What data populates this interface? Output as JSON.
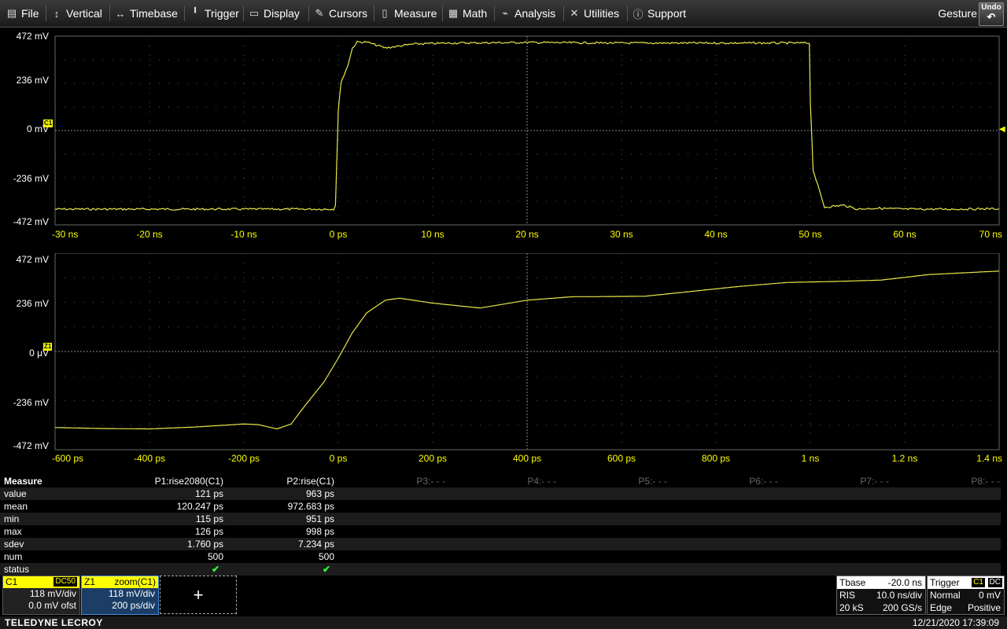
{
  "menu": {
    "items": [
      {
        "label": "File",
        "icon": "file-icon"
      },
      {
        "label": "Vertical",
        "icon": "vertical-arrows-icon"
      },
      {
        "label": "Timebase",
        "icon": "horizontal-arrows-icon"
      },
      {
        "label": "Trigger",
        "icon": "trigger-icon"
      },
      {
        "label": "Display",
        "icon": "display-icon"
      },
      {
        "label": "Cursors",
        "icon": "cursors-icon"
      },
      {
        "label": "Measure",
        "icon": "measure-icon"
      },
      {
        "label": "Math",
        "icon": "math-icon"
      },
      {
        "label": "Analysis",
        "icon": "analysis-icon"
      },
      {
        "label": "Utilities",
        "icon": "utilities-icon"
      },
      {
        "label": "Support",
        "icon": "support-icon"
      }
    ],
    "gesture_label": "Gesture",
    "undo_label": "Undo"
  },
  "chart_data": [
    {
      "type": "line",
      "title": "",
      "channel_tag": "C1",
      "y_tick_labels": [
        "472 mV",
        "236 mV",
        "0 mV",
        "-236 mV",
        "-472 mV"
      ],
      "x_tick_labels": [
        "-30 ns",
        "-20 ns",
        "-10 ns",
        "0 ps",
        "10 ns",
        "20 ns",
        "30 ns",
        "40 ns",
        "50 ns",
        "60 ns",
        "70 ns"
      ],
      "xlim_ns": [
        -30,
        70
      ],
      "ylim_mV": [
        -472,
        472
      ],
      "trace_color": "#e8e84a",
      "series": [
        {
          "x_ns": [
            -30,
            -0.5,
            -0.3,
            0,
            0.3,
            0.6,
            1.0,
            1.5,
            2.0,
            3.0,
            5.0,
            8.0,
            12.0,
            20.0,
            30.0,
            40.0,
            49.9,
            50.0,
            50.3,
            50.6,
            51.5,
            53.5,
            55.0,
            57.0,
            60.0,
            65.0,
            70.0
          ],
          "y_mV": [
            -400,
            -400,
            -380,
            100,
            250,
            280,
            330,
            420,
            450,
            450,
            420,
            440,
            445,
            448,
            445,
            445,
            445,
            150,
            -200,
            -250,
            -390,
            -380,
            -400,
            -395,
            -400,
            -400,
            -398
          ]
        }
      ]
    },
    {
      "type": "line",
      "title": "",
      "channel_tag": "Z1",
      "y_tick_labels": [
        "472 mV",
        "236 mV",
        "0 μV",
        "-236 mV",
        "-472 mV"
      ],
      "x_tick_labels": [
        "-600 ps",
        "-400 ps",
        "-200 ps",
        "0 ps",
        "200 ps",
        "400 ps",
        "600 ps",
        "800 ps",
        "1 ns",
        "1.2 ns",
        "1.4 ns"
      ],
      "xlim_ps": [
        -600,
        1400
      ],
      "ylim_mV": [
        -472,
        472
      ],
      "trace_color": "#e8e84a",
      "series": [
        {
          "x_ps": [
            -600,
            -500,
            -400,
            -300,
            -200,
            -170,
            -130,
            -100,
            -70,
            -30,
            0,
            30,
            60,
            100,
            130,
            200,
            300,
            400,
            500,
            550,
            650,
            750,
            850,
            950,
            1050,
            1150,
            1250,
            1400
          ],
          "y_mV": [
            -383,
            -388,
            -390,
            -380,
            -365,
            -368,
            -390,
            -365,
            -270,
            -150,
            -30,
            100,
            200,
            265,
            275,
            250,
            225,
            265,
            283,
            283,
            285,
            310,
            335,
            355,
            360,
            367,
            395,
            413
          ]
        }
      ]
    }
  ],
  "measure": {
    "header": [
      "Measure",
      "P1:rise2080(C1)",
      "P2:rise(C1)",
      "P3:- - -",
      "P4:- - -",
      "P5:- - -",
      "P6:- - -",
      "P7:- - -",
      "P8:- - -"
    ],
    "rows": [
      {
        "name": "value",
        "p1": "121 ps",
        "p2": "963 ps"
      },
      {
        "name": "mean",
        "p1": "120.247 ps",
        "p2": "972.683 ps"
      },
      {
        "name": "min",
        "p1": "115 ps",
        "p2": "951 ps"
      },
      {
        "name": "max",
        "p1": "126 ps",
        "p2": "998 ps"
      },
      {
        "name": "sdev",
        "p1": "1.760 ps",
        "p2": "7.234 ps"
      },
      {
        "name": "num",
        "p1": "500",
        "p2": "500"
      },
      {
        "name": "status",
        "p1": "✔",
        "p2": "✔"
      }
    ]
  },
  "descriptors": {
    "c1": {
      "name": "C1",
      "coupling": "DC50",
      "vdiv": "118 mV/div",
      "offset": "0.0 mV ofst",
      "color": "#ffff00"
    },
    "z1": {
      "name": "Z1",
      "source": "zoom(C1)",
      "vdiv": "118 mV/div",
      "tdiv": "200 ps/div",
      "color": "#ffff00"
    },
    "add_label": "+"
  },
  "timebase": {
    "label": "Tbase",
    "delay": "-20.0 ns",
    "mode": "RIS",
    "tdiv": "10.0 ns/div",
    "samples": "20 kS",
    "rate": "200 GS/s"
  },
  "trigger": {
    "label": "Trigger",
    "src": "C1",
    "coupling": "DC",
    "mode": "Normal",
    "level": "0 mV",
    "type": "Edge",
    "slope": "Positive"
  },
  "footer": {
    "brand": "TELEDYNE LECROY",
    "datetime": "12/21/2020 17:39:09"
  }
}
